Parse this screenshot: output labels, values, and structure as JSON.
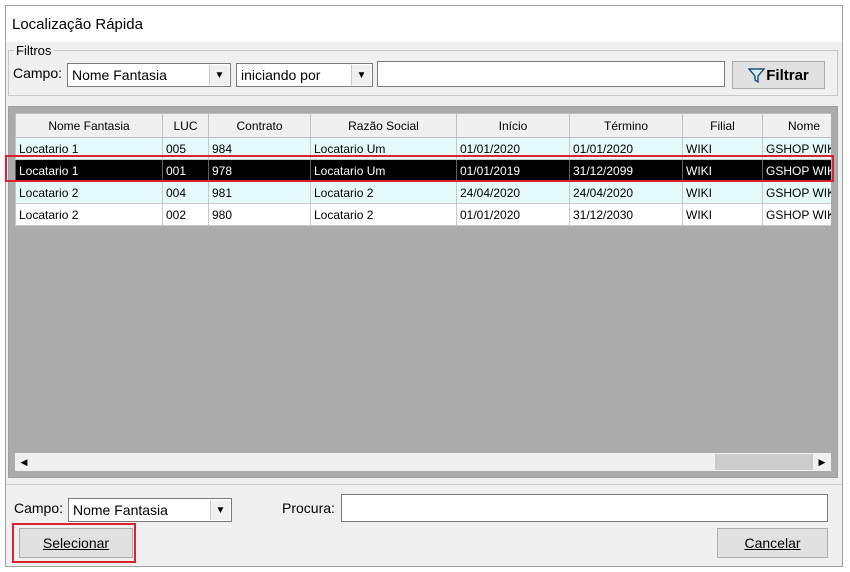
{
  "window": {
    "title": "Localização Rápida"
  },
  "filters": {
    "group_label": "Filtros",
    "field_label": "Campo:",
    "field_value": "Nome Fantasia",
    "operator_value": "iniciando por",
    "search_value": "",
    "filter_button": "Filtrar"
  },
  "grid": {
    "columns": [
      "Nome Fantasia",
      "LUC",
      "Contrato",
      "Razão Social",
      "Início",
      "Término",
      "Filial",
      "Nome"
    ],
    "rows": [
      [
        "Locatario 1",
        "005",
        "984",
        "Locatario Um",
        "01/01/2020",
        "01/01/2020",
        "WIKI",
        "GSHOP WIK"
      ],
      [
        "Locatario 1",
        "001",
        "978",
        "Locatario Um",
        "01/01/2019",
        "31/12/2099",
        "WIKI",
        "GSHOP WIK"
      ],
      [
        "Locatario 2",
        "004",
        "981",
        "Locatario 2",
        "24/04/2020",
        "24/04/2020",
        "WIKI",
        "GSHOP WIK"
      ],
      [
        "Locatario 2",
        "002",
        "980",
        "Locatario 2",
        "01/01/2020",
        "31/12/2030",
        "WIKI",
        "GSHOP WIK"
      ]
    ],
    "selected_row": 1
  },
  "bottom": {
    "field_label": "Campo:",
    "field_value": "Nome Fantasia",
    "search_label": "Procura:",
    "search_value": "",
    "select_button": "Selecionar",
    "cancel_button": "Cancelar"
  },
  "colors": {
    "selection_outline": "#d9232e",
    "row_tint": "#e5fbfb",
    "grid_background": "#ababab"
  }
}
